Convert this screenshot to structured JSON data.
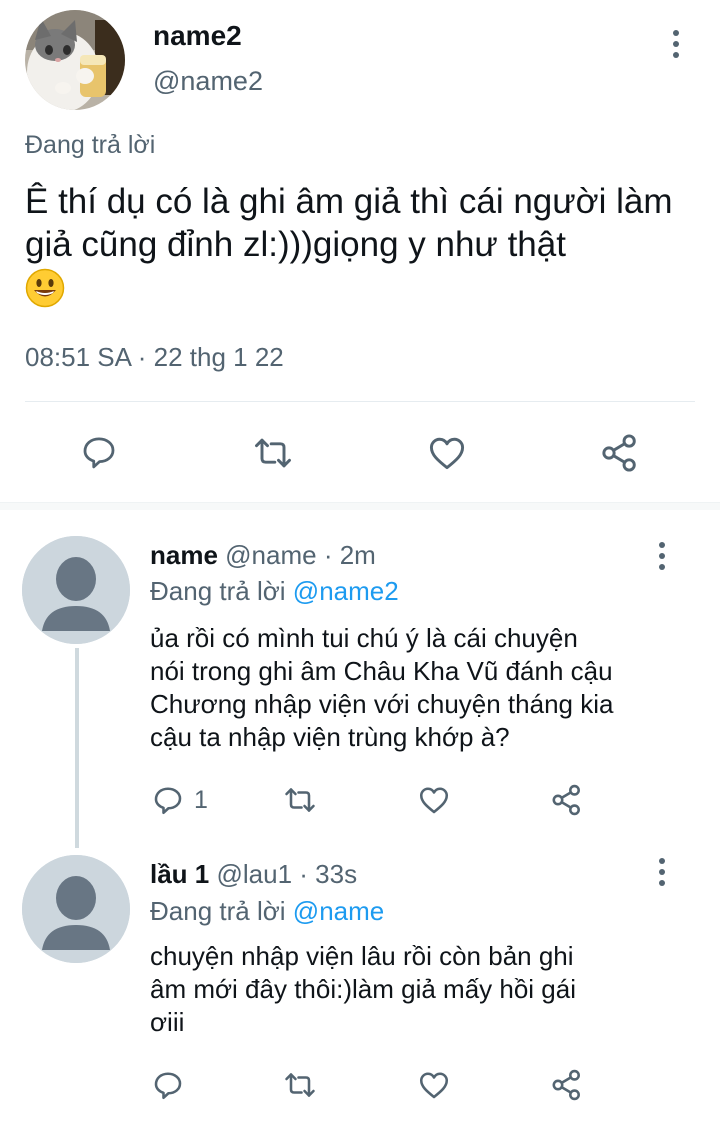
{
  "main_tweet": {
    "display_name": "name2",
    "handle": "@name2",
    "replying_label": "Đang trả lời",
    "text": "Ê thí dụ có là ghi âm giả thì cái người làm giả cũng đỉnh zl:)))giọng y như thật",
    "emoji": "smiley-emoji",
    "timestamp": "08:51 SA · 22 thg 1 22"
  },
  "replies": [
    {
      "display_name": "name",
      "handle": "@name",
      "time_ago": "2m",
      "replying_label": "Đang trả lời",
      "replying_to": "@name2",
      "text_lines": [
        "ủa rồi có mình tui chú ý là cái chuyện",
        "nói trong ghi âm Châu Kha Vũ đánh cậu",
        "Chương nhập viện với chuyện tháng kia",
        "cậu ta nhập viện trùng khớp à?"
      ],
      "reply_count": "1"
    },
    {
      "display_name": "lầu 1",
      "handle": "@lau1",
      "time_ago": "33s",
      "replying_label": "Đang trả lời",
      "replying_to": "@name",
      "text_lines": [
        "chuyện nhập viện lâu rồi còn bản ghi",
        "âm mới đây thôi:)làm giả mấy hồi gái",
        "ơiii"
      ]
    }
  ],
  "icons": {
    "reply": "reply-icon",
    "retweet": "retweet-icon",
    "like": "like-icon",
    "share": "share-icon",
    "more": "more-icon"
  },
  "colors": {
    "text": "#0f1419",
    "secondary": "#536471",
    "accent": "#1d9bf0",
    "avatar_placeholder": "#ccd6dd",
    "avatar_figure": "#687684"
  }
}
